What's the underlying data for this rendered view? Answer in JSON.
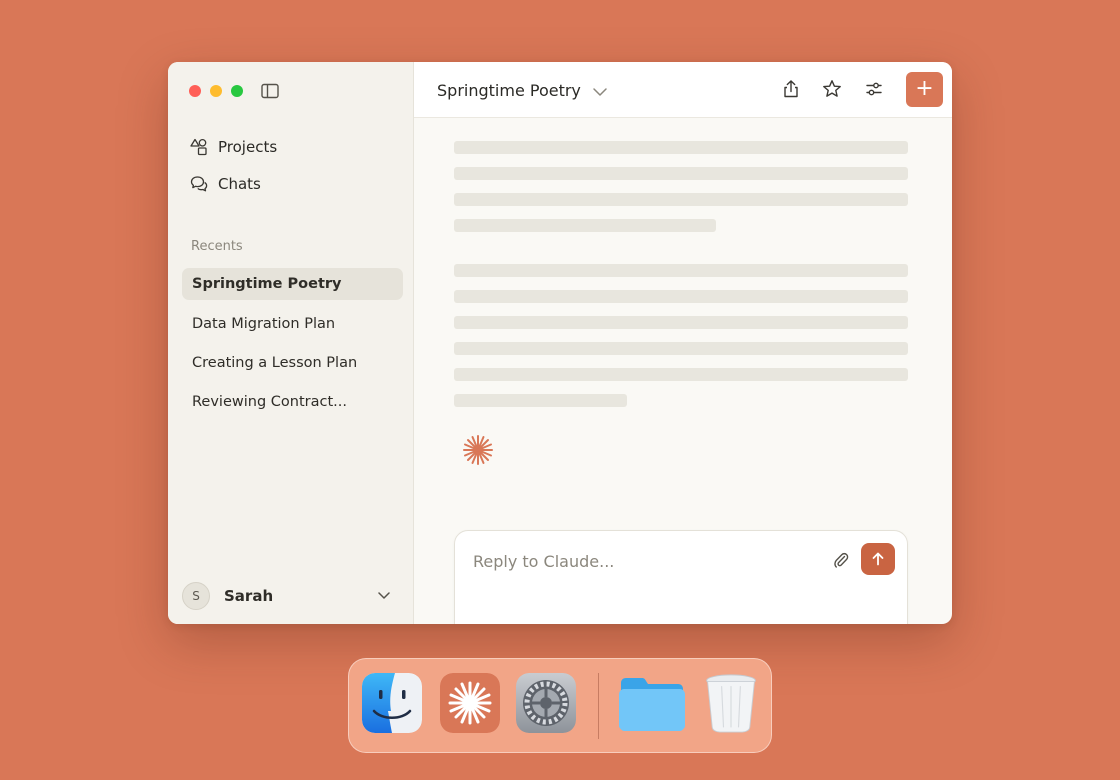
{
  "window": {
    "title": "Springtime Poetry"
  },
  "sidebar": {
    "nav": [
      {
        "label": "Projects",
        "icon": "shapes-icon"
      },
      {
        "label": "Chats",
        "icon": "chat-bubbles-icon"
      }
    ],
    "recents_label": "Recents",
    "recents": [
      {
        "label": "Springtime Poetry",
        "active": true
      },
      {
        "label": "Data Migration Plan",
        "active": false
      },
      {
        "label": "Creating a Lesson Plan",
        "active": false
      },
      {
        "label": "Reviewing Contract...",
        "active": false
      }
    ],
    "user": {
      "initial": "S",
      "name": "Sarah"
    }
  },
  "header": {
    "title": "Springtime Poetry",
    "icons": [
      "share-icon",
      "star-icon",
      "sliders-icon",
      "plus-icon"
    ]
  },
  "composer": {
    "placeholder": "Reply to Claude..."
  },
  "dock": {
    "apps": [
      "finder-icon",
      "claude-app-icon",
      "system-settings-icon",
      "folder-icon",
      "trash-icon"
    ]
  },
  "colors": {
    "background": "#d97757",
    "accent": "#d97757",
    "send": "#c96442",
    "sidebar": "#f4f2ec",
    "active_item": "#e6e3da"
  }
}
